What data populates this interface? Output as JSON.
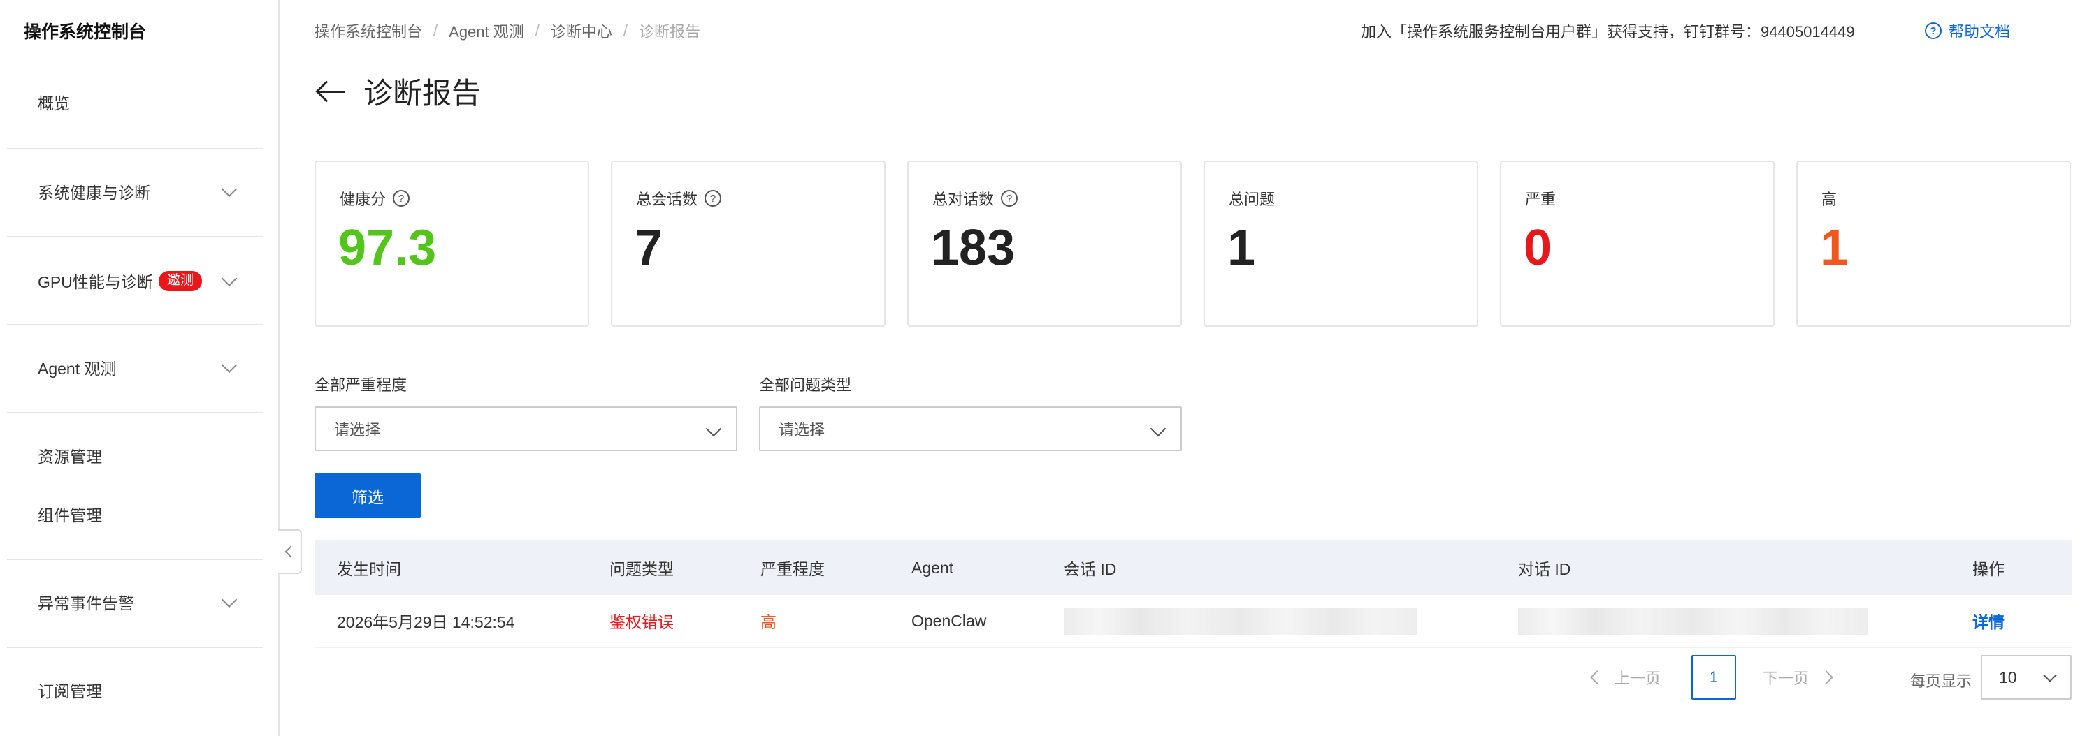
{
  "sidebar": {
    "title": "操作系统控制台",
    "items": [
      {
        "label": "概览"
      },
      {
        "label": "系统健康与诊断"
      },
      {
        "label": "GPU性能与诊断",
        "badge": "邀测"
      },
      {
        "label": "Agent 观测"
      },
      {
        "label": "资源管理"
      },
      {
        "label": "组件管理"
      },
      {
        "label": "异常事件告警"
      },
      {
        "label": "订阅管理"
      }
    ]
  },
  "header": {
    "breadcrumb": [
      "操作系统控制台",
      "Agent 观测",
      "诊断中心",
      "诊断报告"
    ],
    "breadcrumb_sep": "/",
    "support_text": "加入「操作系统服务控制台用户群」获得支持，钉钉群号：94405014449",
    "help_label": "帮助文档",
    "help_icon": "?"
  },
  "page": {
    "title": "诊断报告"
  },
  "cards": [
    {
      "label": "健康分",
      "value": "97.3",
      "info": "?",
      "color": "#52c41a"
    },
    {
      "label": "总会话数",
      "value": "7",
      "info": "?",
      "color": "#222222"
    },
    {
      "label": "总对话数",
      "value": "183",
      "info": "?",
      "color": "#222222"
    },
    {
      "label": "总问题",
      "value": "1",
      "color": "#222222"
    },
    {
      "label": "严重",
      "value": "0",
      "color": "#e8171b"
    },
    {
      "label": "高",
      "value": "1",
      "color": "#f2561d"
    }
  ],
  "filters": {
    "severity": {
      "label": "全部严重程度",
      "placeholder": "请选择"
    },
    "issue_type": {
      "label": "全部问题类型",
      "placeholder": "请选择"
    },
    "submit_label": "筛选"
  },
  "table": {
    "columns": [
      "发生时间",
      "问题类型",
      "严重程度",
      "Agent",
      "会话 ID",
      "对话 ID",
      "操作"
    ],
    "rows": [
      {
        "time": "2026年5月29日 14:52:54",
        "issue_type": "鉴权错误",
        "severity": "高",
        "agent": "OpenClaw",
        "action": "详情"
      }
    ]
  },
  "pagination": {
    "prev": "上一页",
    "current": "1",
    "next": "下一页",
    "per_page_label": "每页显示",
    "per_page_value": "10"
  },
  "colors": {
    "accent": "#0b66d6",
    "danger": "#e8171b",
    "warning": "#f2561d",
    "success": "#52c41a"
  }
}
